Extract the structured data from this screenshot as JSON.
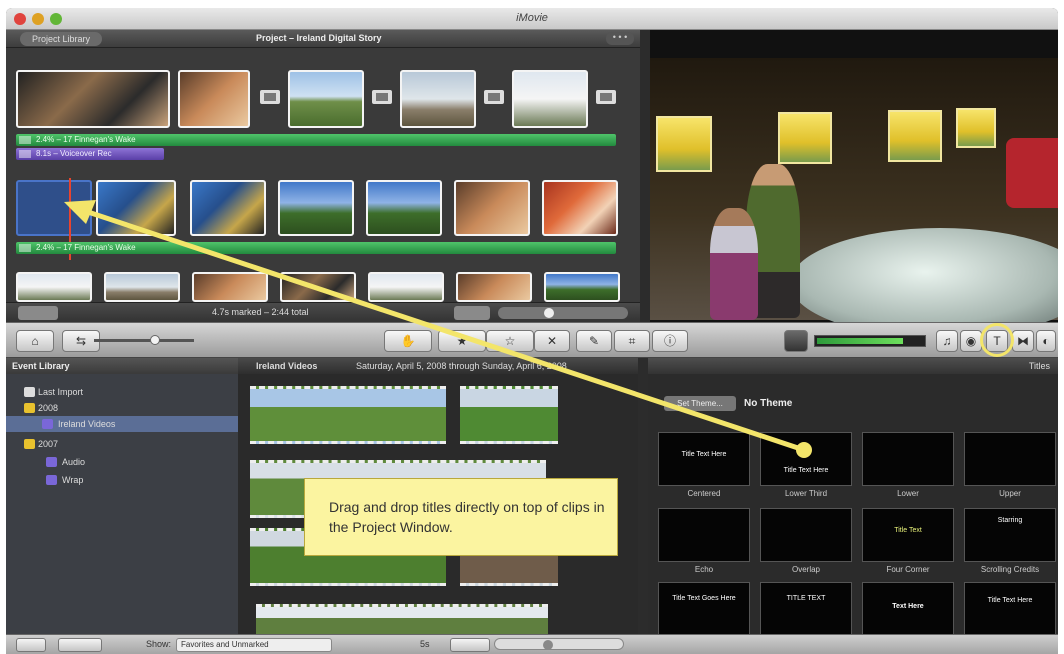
{
  "window": {
    "title": "iMovie"
  },
  "project": {
    "library_button": "Project Library",
    "title": "Project – Ireland Digital Story",
    "more_button": "• • •",
    "music_bar_1": "2.4% – 17 Finnegan's Wake",
    "voiceover_bar": "8.1s – Voiceover Rec",
    "music_bar_2": "2.4% – 17 Finnegan's Wake",
    "status": "4.7s marked – 2:44 total"
  },
  "toolbar": {
    "zoom_min_icon": "small-thumb-icon",
    "zoom_max_icon": "large-thumb-icon"
  },
  "event_library": {
    "header": "Event Library",
    "items": [
      {
        "label": "Last Import",
        "level": 1
      },
      {
        "label": "2008",
        "level": 0
      },
      {
        "label": "Ireland Videos",
        "level": 1,
        "selected": true
      },
      {
        "label": "2007",
        "level": 0
      },
      {
        "label": "Audio",
        "level": 1
      },
      {
        "label": "Wrap",
        "level": 1
      }
    ]
  },
  "events": {
    "event_name": "Ireland Videos",
    "date_range": "Saturday, April 5, 2008 through Sunday, April 6, 2008"
  },
  "titles": {
    "header": "Titles",
    "set_theme_button": "Set Theme...",
    "theme_label": "No Theme",
    "tiles": [
      {
        "label": "Centered",
        "text": "Title Text Here"
      },
      {
        "label": "Lower Third",
        "text": "Title Text Here"
      },
      {
        "label": "Lower",
        "text": ""
      },
      {
        "label": "Upper",
        "text": ""
      },
      {
        "label": "Echo",
        "text": ""
      },
      {
        "label": "Overlap",
        "text": ""
      },
      {
        "label": "Four Corner",
        "text": "Title Text"
      },
      {
        "label": "Scrolling Credits",
        "text": "Starring"
      },
      {
        "label": "",
        "text": "Title Text Goes Here"
      },
      {
        "label": "",
        "text": "TITLE TEXT"
      },
      {
        "label": "",
        "text": "Text Here"
      },
      {
        "label": "",
        "text": "Title Text Here"
      }
    ]
  },
  "bottombar": {
    "show_label": "Show:",
    "show_value": "Favorites and Unmarked",
    "duration_label": "5s"
  },
  "callout": {
    "text": "Drag and drop titles directly on top of clips in the Project Window."
  },
  "colors": {
    "accent_green": "#2fa84c",
    "accent_purple": "#6b4fbf",
    "callout_yellow": "#fbf4a0",
    "highlight_yellow": "#f3e56a",
    "playhead_red": "#e8442e"
  }
}
